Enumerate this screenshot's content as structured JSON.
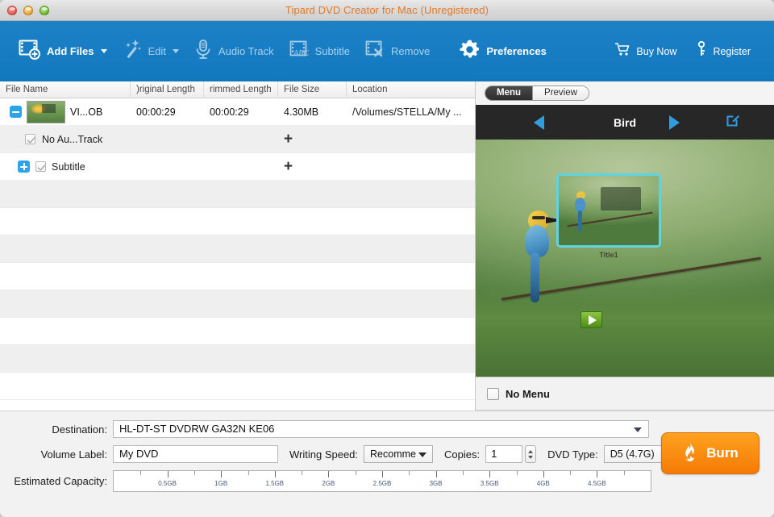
{
  "window": {
    "title": "Tipard DVD Creator for Mac (Unregistered)",
    "traffic_lights": [
      "close-button",
      "minimize-button",
      "zoom-button"
    ]
  },
  "toolbar": {
    "items": [
      {
        "label": "Add Files",
        "icon": "add-files-icon",
        "has_caret": true,
        "enabled": true
      },
      {
        "label": "Edit",
        "icon": "magic-wand-icon",
        "has_caret": true,
        "enabled": false
      },
      {
        "label": "Audio Track",
        "icon": "microphone-icon",
        "has_caret": false,
        "enabled": false
      },
      {
        "label": "Subtitle",
        "icon": "subtitle-abc-icon",
        "has_caret": false,
        "enabled": false
      },
      {
        "label": "Remove",
        "icon": "remove-film-icon",
        "has_caret": false,
        "enabled": false
      },
      {
        "label": "Preferences",
        "icon": "gear-icon",
        "has_caret": false,
        "enabled": true
      }
    ],
    "right_items": [
      {
        "label": "Buy Now",
        "icon": "cart-icon"
      },
      {
        "label": "Register",
        "icon": "key-icon"
      }
    ]
  },
  "file_table": {
    "columns": [
      "File Name",
      ")riginal Length",
      "rimmed Length",
      "File Size",
      "Location"
    ],
    "rows": [
      {
        "type": "file",
        "toggle": "minus",
        "name": "VI...OB",
        "original_length": "00:00:29",
        "trimmed_length": "00:00:29",
        "file_size": "4.30MB",
        "location": "/Volumes/STELLA/My ..."
      },
      {
        "type": "audio",
        "checked": true,
        "label": "No Au...Track",
        "action": "+"
      },
      {
        "type": "subtitle",
        "toggle": "plus",
        "checked": true,
        "label": "Subtitle",
        "action": "+"
      }
    ],
    "empty_rows": 8
  },
  "menu_panel": {
    "tabs": [
      {
        "label": "Menu",
        "active": true
      },
      {
        "label": "Preview",
        "active": false
      }
    ],
    "template_name": "Bird",
    "prev_icon": "previous-arrow-icon",
    "next_icon": "next-arrow-icon",
    "edit_icon": "edit-pencil-icon",
    "thumbnail_caption": "Title1",
    "play_icon": "play-button-icon",
    "no_menu": {
      "label": "No Menu",
      "checked": false
    }
  },
  "bottom": {
    "destination": {
      "label": "Destination:",
      "value": "HL-DT-ST DVDRW  GA32N KE06"
    },
    "volume_label": {
      "label": "Volume Label:",
      "value": "My DVD"
    },
    "writing_speed": {
      "label": "Writing Speed:",
      "value": "Recomme"
    },
    "copies": {
      "label": "Copies:",
      "value": "1"
    },
    "dvd_type": {
      "label": "DVD Type:",
      "value": "D5 (4.7G)"
    },
    "estimated_capacity": {
      "label": "Estimated Capacity:",
      "ticks": [
        "0.5GB",
        "1GB",
        "1.5GB",
        "2GB",
        "2.5GB",
        "3GB",
        "3.5GB",
        "4GB",
        "4.5GB"
      ]
    },
    "burn_button": {
      "label": "Burn",
      "icon": "flame-icon"
    }
  },
  "colors": {
    "toolbar_blue": "#1278bd",
    "accent_blue": "#2aa3e8",
    "burn_orange": "#f57a05",
    "title_orange": "#e07a2a",
    "selection_cyan": "#5fd4e0"
  }
}
